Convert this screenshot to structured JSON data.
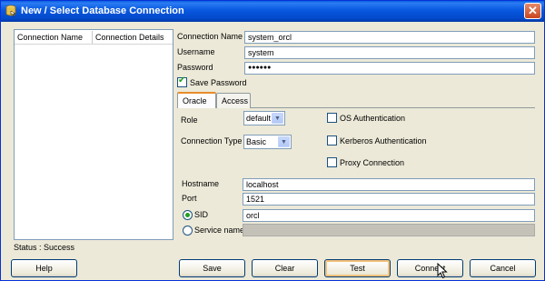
{
  "window": {
    "title": "New / Select Database Connection",
    "close_glyph": "✕"
  },
  "connection_list": {
    "columns": [
      "Connection Name",
      "Connection Details"
    ],
    "rows": []
  },
  "status_text": "Status : Success",
  "fields": {
    "connection_name": {
      "label": "Connection Name",
      "value": "system_orcl"
    },
    "username": {
      "label": "Username",
      "value": "system"
    },
    "password": {
      "label": "Password",
      "value": "●●●●●●"
    },
    "save_password": {
      "label": "Save Password",
      "checked": true
    }
  },
  "tabs": [
    {
      "label": "Oracle",
      "active": true
    },
    {
      "label": "Access",
      "active": false
    }
  ],
  "oracle": {
    "role": {
      "label": "Role",
      "value": "default"
    },
    "connection_type": {
      "label": "Connection Type",
      "value": "Basic"
    },
    "os_auth": {
      "label": "OS Authentication",
      "checked": false
    },
    "kerberos_auth": {
      "label": "Kerberos Authentication",
      "checked": false
    },
    "proxy_connection": {
      "label": "Proxy Connection",
      "checked": false
    },
    "hostname": {
      "label": "Hostname",
      "value": "localhost"
    },
    "port": {
      "label": "Port",
      "value": "1521"
    },
    "sid": {
      "label": "SID",
      "value": "orcl",
      "selected": true
    },
    "service_name": {
      "label": "Service name",
      "value": "",
      "selected": false
    }
  },
  "buttons": {
    "help": "Help",
    "save": "Save",
    "clear": "Clear",
    "test": "Test",
    "connect": "Connect",
    "cancel": "Cancel"
  },
  "colors": {
    "titlebar": "#0858e0",
    "accent_tab": "#e68b2c",
    "check": "#21a121"
  }
}
